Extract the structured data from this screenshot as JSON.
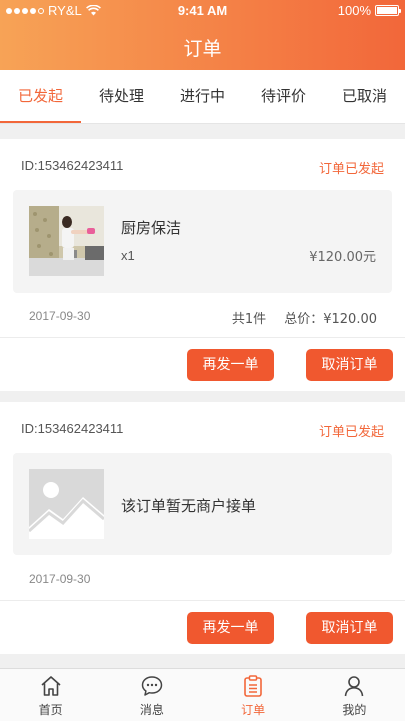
{
  "status_bar": {
    "carrier": "RY&L",
    "time": "9:41 AM",
    "battery": "100%"
  },
  "header": {
    "title": "订单"
  },
  "tabs": [
    {
      "label": "已发起",
      "active": true
    },
    {
      "label": "待处理",
      "active": false
    },
    {
      "label": "进行中",
      "active": false
    },
    {
      "label": "待评价",
      "active": false
    },
    {
      "label": "已取消",
      "active": false
    }
  ],
  "orders": [
    {
      "id": "ID:153462423411",
      "status": "订单已发起",
      "item_name": "厨房保洁",
      "quantity": "x1",
      "price": "¥120.00元",
      "date": "2017-09-30",
      "count": "共1件",
      "total": "总价：¥120.00",
      "buttons": {
        "reorder": "再发一单",
        "cancel": "取消订单"
      },
      "thumbnail_icon": "cleaning-photo"
    },
    {
      "id": "ID:153462423411",
      "status": "订单已发起",
      "item_name": "该订单暂无商户接单",
      "date": "2017-09-30",
      "buttons": {
        "reorder": "再发一单",
        "cancel": "取消订单"
      },
      "thumbnail_icon": "image-placeholder-icon"
    }
  ],
  "tabbar": [
    {
      "label": "首页",
      "icon": "home-icon",
      "active": false
    },
    {
      "label": "消息",
      "icon": "message-icon",
      "active": false
    },
    {
      "label": "订单",
      "icon": "clipboard-icon",
      "active": true
    },
    {
      "label": "我的",
      "icon": "user-icon",
      "active": false
    }
  ],
  "colors": {
    "accent": "#f2673a",
    "header_gradient_start": "#f7a356",
    "button": "#f0582f"
  }
}
